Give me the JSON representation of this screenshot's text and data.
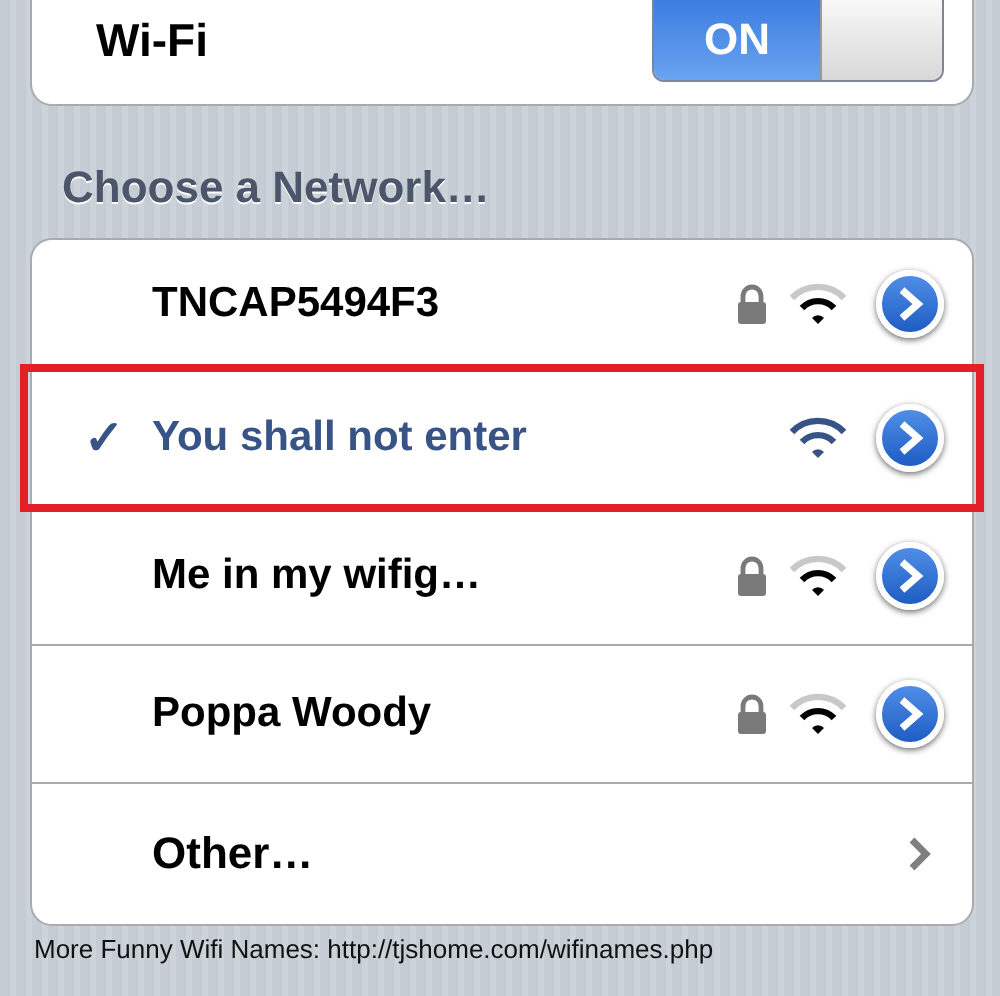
{
  "wifi": {
    "label": "Wi-Fi",
    "on": true,
    "switch_label": "ON"
  },
  "section_title": "Choose a Network…",
  "networks": [
    {
      "name": "TNCAP5494F3",
      "selected": false,
      "locked": true,
      "highlighted": false
    },
    {
      "name": "You shall not enter",
      "selected": true,
      "locked": false,
      "highlighted": true
    },
    {
      "name": "Me in my wifig…",
      "selected": false,
      "locked": true,
      "highlighted": false
    },
    {
      "name": "Poppa Woody",
      "selected": false,
      "locked": true,
      "highlighted": false
    }
  ],
  "other": {
    "label": "Other…"
  },
  "check_mark": "✓",
  "caption": "More Funny Wifi Names: http://tjshome.com/wifinames.php"
}
